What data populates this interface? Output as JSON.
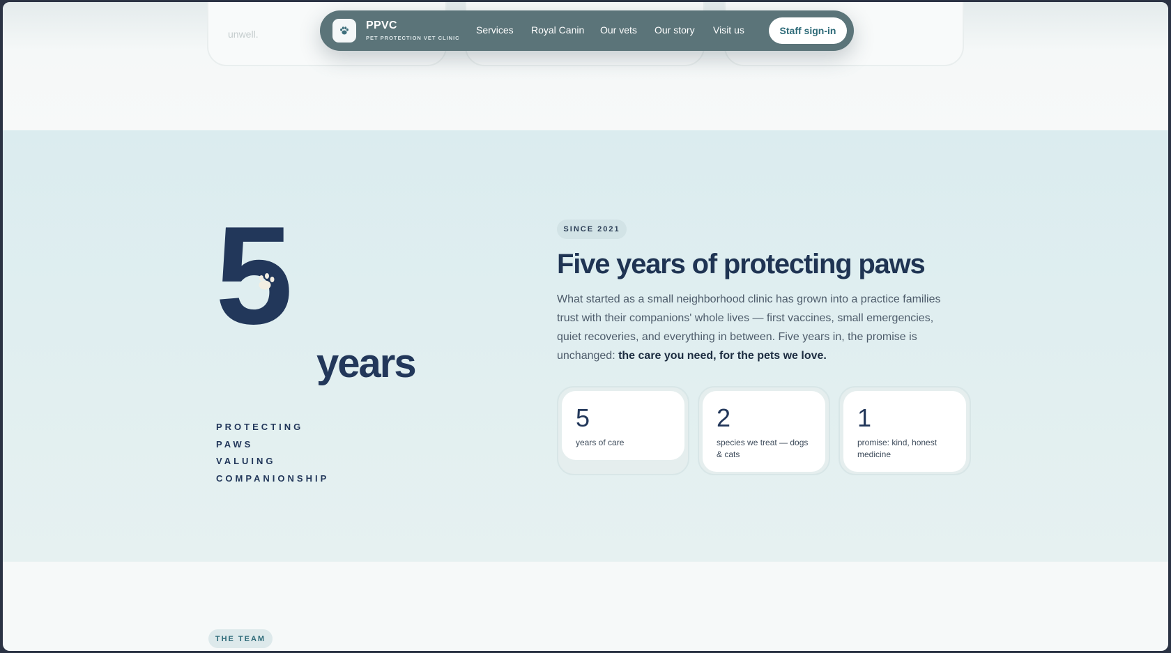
{
  "background_faded_text": "unwell.",
  "nav": {
    "brand_name": "PPVC",
    "brand_sub": "PET PROTECTION VET CLINIC",
    "links": [
      "Services",
      "Royal Canin",
      "Our vets",
      "Our story",
      "Visit us"
    ],
    "signin_label": "Staff sign-in",
    "logo_icon": "paw-icon"
  },
  "story": {
    "big_number": "5",
    "big_word": "years",
    "tagline": [
      "PROTECTING",
      "PAWS",
      "VALUING",
      "COMPANIONSHIP"
    ],
    "since_label": "SINCE 2021",
    "title": "Five years of protecting paws",
    "body": "What started as a small neighborhood clinic has grown into a practice families trust with their companions' whole lives — first vaccines, small emergencies, quiet recoveries, and everything in between. Five years in, the promise is unchanged: ",
    "body_strong": "the care you need, for the pets we love.",
    "stats": [
      {
        "number": "5",
        "label": "years of care"
      },
      {
        "number": "2",
        "label": "species we treat — dogs & cats"
      },
      {
        "number": "1",
        "label": "promise: kind, honest medicine"
      }
    ]
  },
  "team": {
    "label": "THE TEAM"
  },
  "colors": {
    "navy": "#22375a",
    "teal_nav": "#5b7479",
    "accent": "#2d6a78",
    "section_bg": "#dbecef"
  }
}
